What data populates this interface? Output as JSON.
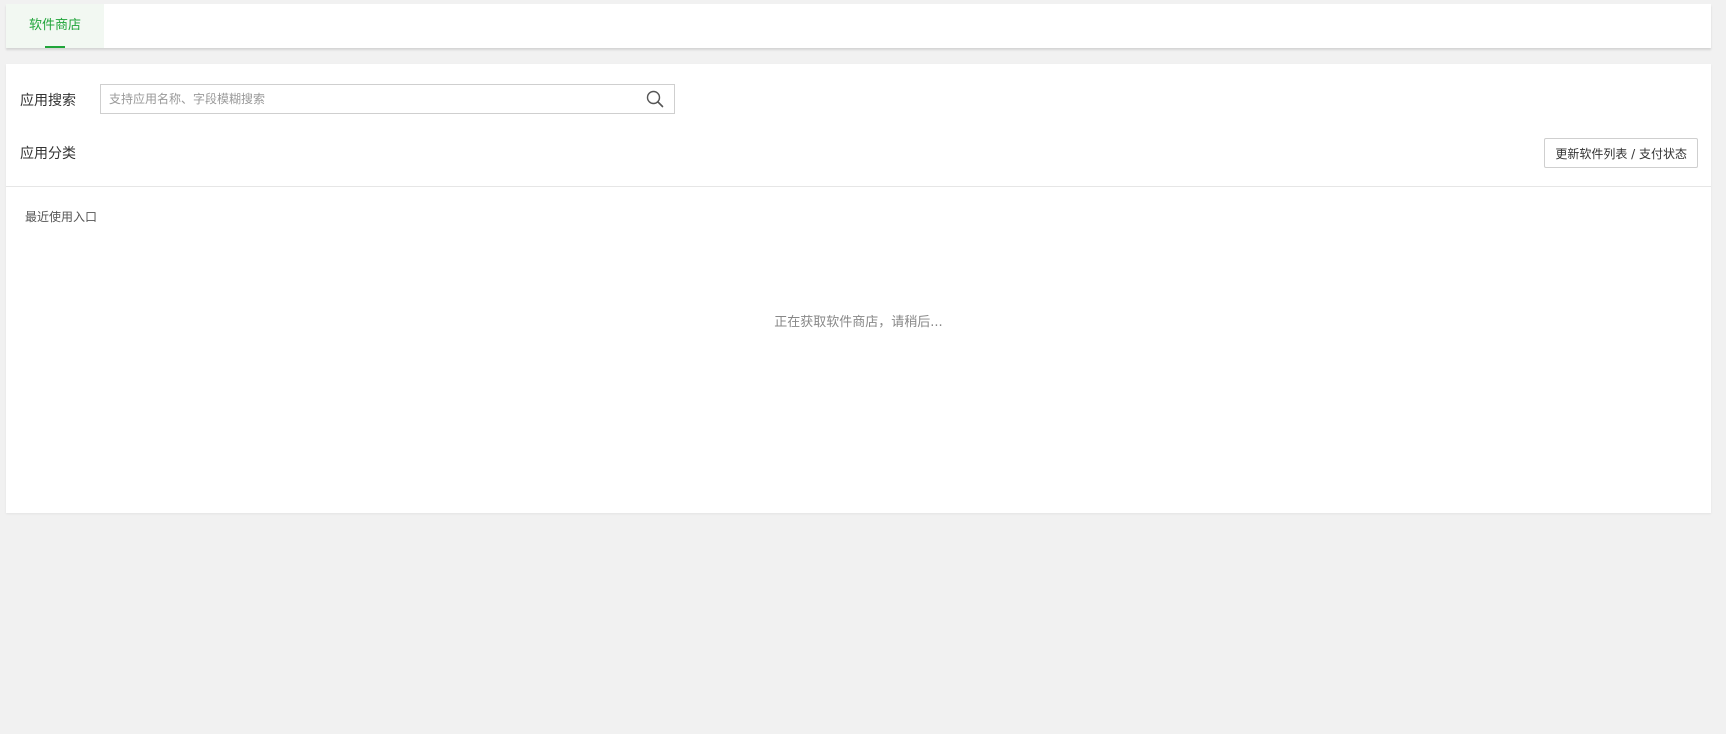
{
  "tabs": [
    {
      "label": "软件商店",
      "active": true
    }
  ],
  "search": {
    "label": "应用搜索",
    "placeholder": "支持应用名称、字段模糊搜索",
    "value": ""
  },
  "category": {
    "label": "应用分类"
  },
  "toolbar": {
    "update_label": "更新软件列表 / 支付状态"
  },
  "recent": {
    "label": "最近使用入口"
  },
  "status": {
    "loading": "正在获取软件商店，请稍后..."
  },
  "colors": {
    "accent": "#20a53a",
    "background": "#f1f1f1",
    "panel": "#ffffff"
  }
}
